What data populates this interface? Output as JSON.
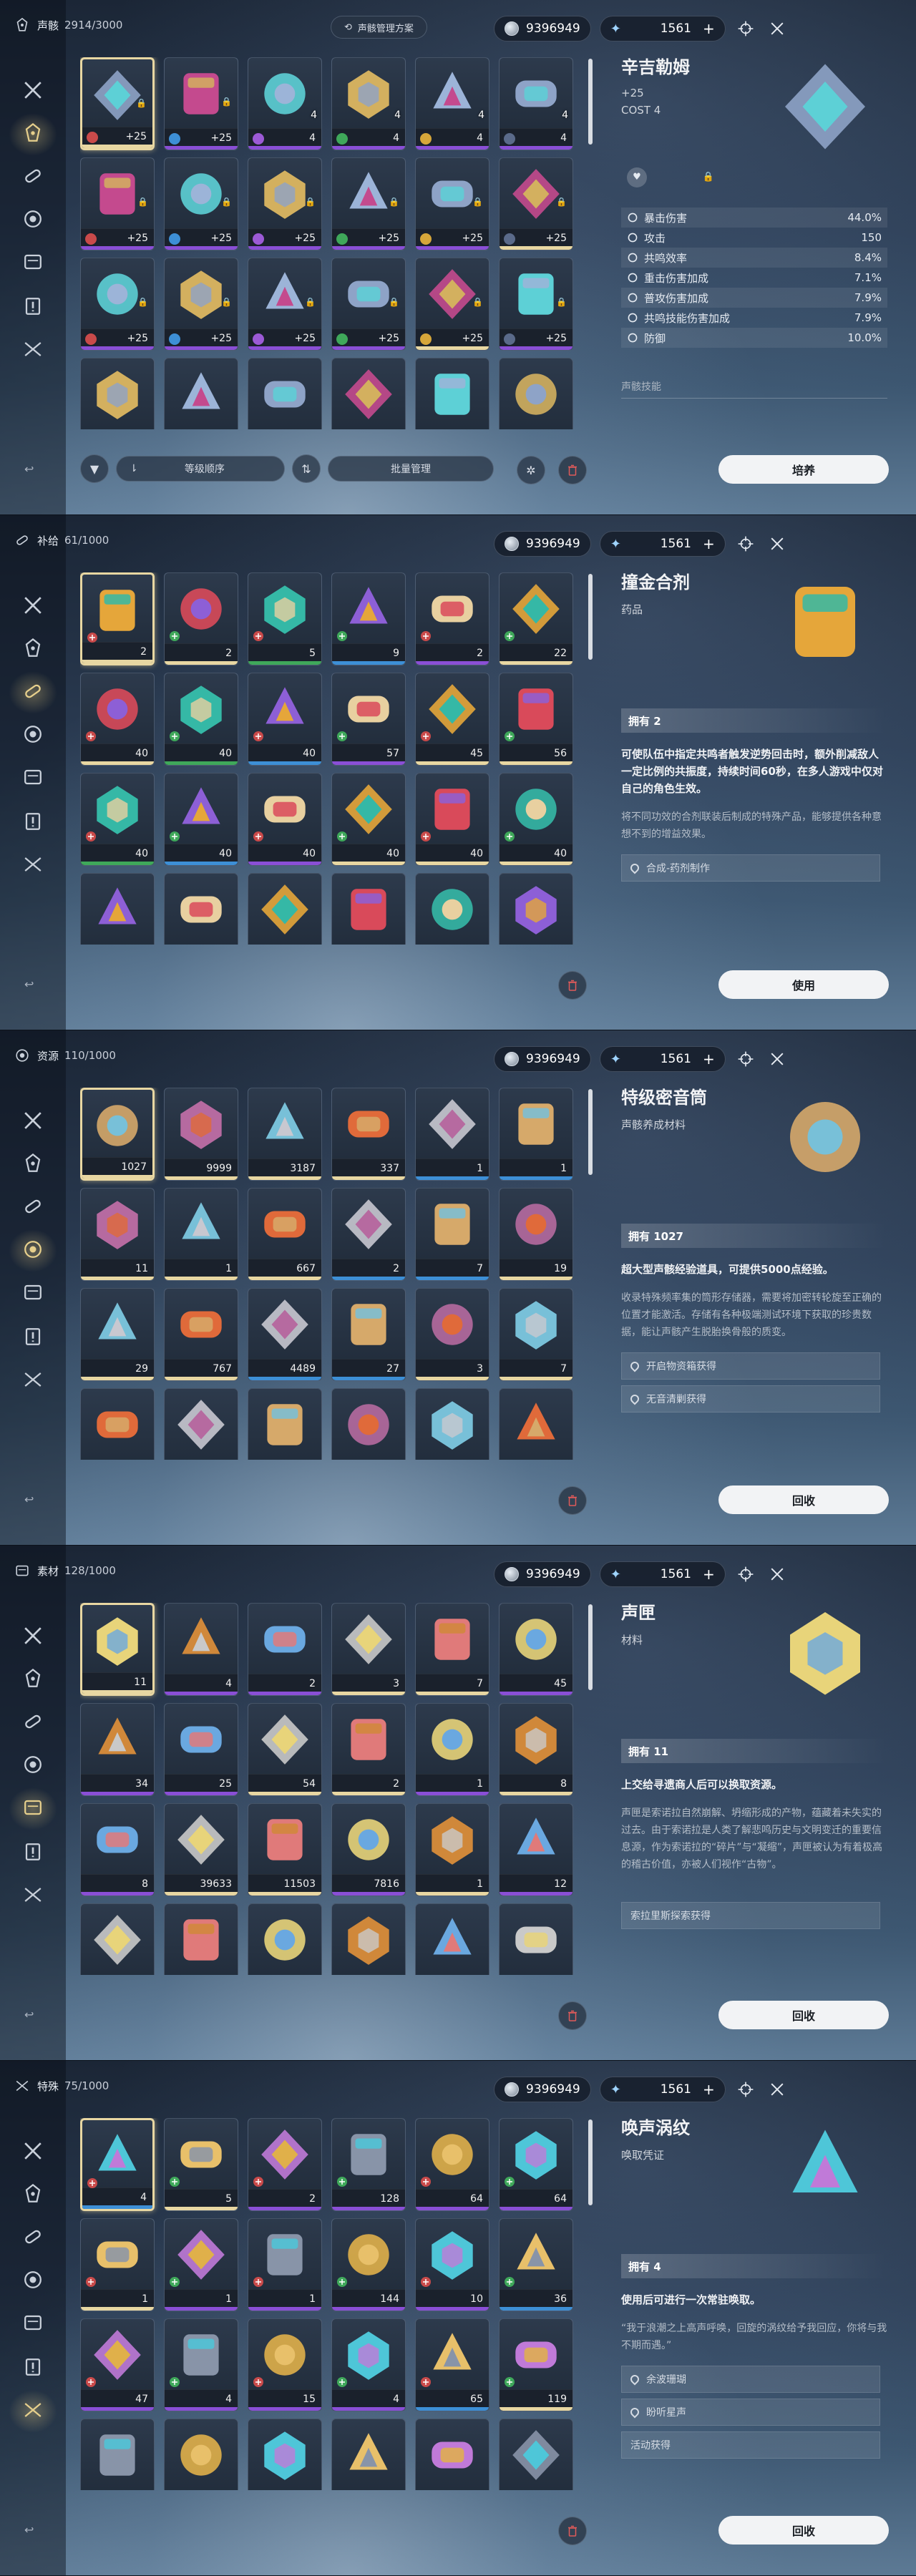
{
  "common": {
    "currency": "9396949",
    "star_count": "1561"
  },
  "panels": [
    {
      "key": "echo",
      "title": "声骸",
      "count": "2914/3000",
      "plan_label": "声骸管理方案",
      "detail": {
        "name": "辛吉勒姆",
        "level": "+25",
        "cost": "COST 4",
        "stats": [
          {
            "label": "暴击伤害",
            "value": "44.0%"
          },
          {
            "label": "攻击",
            "value": "150"
          },
          {
            "label": "共鸣效率",
            "value": "8.4%"
          },
          {
            "label": "重击伤害加成",
            "value": "7.1%"
          },
          {
            "label": "普攻伤害加成",
            "value": "7.9%"
          },
          {
            "label": "共鸣技能伤害加成",
            "value": "7.9%"
          },
          {
            "label": "防御",
            "value": "10.0%"
          }
        ],
        "skill_label": "声骸技能"
      },
      "sort_label": "等级顺序",
      "batch_label": "批量管理",
      "button": "培养"
    },
    {
      "key": "supply",
      "title": "补给",
      "count": "61/1000",
      "detail": {
        "name": "撞金合剂",
        "type": "药品",
        "own": "拥有 2",
        "desc": "可使队伍中指定共鸣者触发逆势回击时，额外削减敌人一定比例的共振度，持续时间60秒，在多人游戏中仅对自己的角色生效。",
        "lore": "将不同功效的合剂联装后制成的特殊产品，能够提供各种意想不到的增益效果。",
        "sources": [
          "合成-药剂制作"
        ]
      },
      "button": "使用"
    },
    {
      "key": "resource",
      "title": "资源",
      "count": "110/1000",
      "detail": {
        "name": "特级密音筒",
        "type": "声骸养成材料",
        "own": "拥有 1027",
        "desc": "超大型声骸经验道具，可提供5000点经验。",
        "lore": "收录特殊频率集的筒形存储器，需要将加密转轮旋至正确的位置才能激活。存储有各种极端测试环境下获取的珍贵数据，能让声骸产生脱胎换骨般的质变。",
        "sources": [
          "开启物资箱获得",
          "无音清剿获得"
        ]
      },
      "button": "回收"
    },
    {
      "key": "material",
      "title": "素材",
      "count": "128/1000",
      "detail": {
        "name": "声匣",
        "type": "材料",
        "own": "拥有 11",
        "desc": "上交给寻遗商人后可以换取资源。",
        "lore": "声匣是索诺拉自然崩解、坍缩形成的产物，蕴藏着未失实的过去。由于索诺拉是人类了解悲鸣历史与文明变迁的重要信息源，作为索诺拉的“碎片”与“凝缩”，声匣被认为有着极高的稽古价值，亦被人们视作“古物”。",
        "sources": [
          "索拉里斯探索获得"
        ]
      },
      "button": "回收"
    },
    {
      "key": "special",
      "title": "特殊",
      "count": "75/1000",
      "detail": {
        "name": "唤声涡纹",
        "type": "唤取凭证",
        "own": "拥有 4",
        "desc": "使用后可进行一次常驻唤取。",
        "lore": "“我于浪潮之上高声呼唤，回旋的涡纹给予我回应，你将与我不期而遇。”",
        "sources": [
          "余波珊瑚",
          "盼听星声",
          "活动获得"
        ]
      },
      "button": "回收"
    }
  ],
  "grids": [
    [
      [
        "+25",
        "+25",
        "4",
        "4",
        "4",
        "4"
      ],
      [
        "+25",
        "+25",
        "+25",
        "+25",
        "+25",
        "+25"
      ],
      [
        "+25",
        "+25",
        "+25",
        "+25",
        "+25",
        "+25"
      ],
      [
        "",
        "",
        "",
        "",
        "",
        ""
      ]
    ],
    [
      [
        "2",
        "2",
        "5",
        "9",
        "2",
        "22"
      ],
      [
        "40",
        "40",
        "40",
        "57",
        "45",
        "56"
      ],
      [
        "40",
        "40",
        "40",
        "40",
        "40",
        "40"
      ],
      [
        "",
        "",
        "",
        "",
        "",
        ""
      ]
    ],
    [
      [
        "1027",
        "9999",
        "3187",
        "337",
        "1",
        "1"
      ],
      [
        "11",
        "1",
        "667",
        "2",
        "7",
        "19"
      ],
      [
        "29",
        "767",
        "4489",
        "27",
        "3",
        "7"
      ],
      [
        "",
        "",
        "",
        "",
        "",
        ""
      ]
    ],
    [
      [
        "11",
        "4",
        "2",
        "3",
        "7",
        "45"
      ],
      [
        "34",
        "25",
        "54",
        "2",
        "1",
        "8"
      ],
      [
        "8",
        "39633",
        "11503",
        "7816",
        "1",
        "12"
      ],
      [
        "",
        "",
        "",
        "",
        "",
        ""
      ]
    ],
    [
      [
        "4",
        "5",
        "2",
        "128",
        "64",
        "64"
      ],
      [
        "1",
        "1",
        "1",
        "144",
        "10",
        "36"
      ],
      [
        "47",
        "4",
        "15",
        "4",
        "65",
        "119"
      ],
      [
        "",
        "",
        "",
        "",
        "",
        ""
      ]
    ]
  ],
  "grid_tags": {
    "echo_levels": [
      "4",
      "4",
      "4",
      "4",
      "4",
      "4"
    ]
  },
  "colors": {
    "gold": "#e8d7a2",
    "purple": "#8a4fd6",
    "blue": "#3d8fd6",
    "green": "#3fa85a"
  }
}
